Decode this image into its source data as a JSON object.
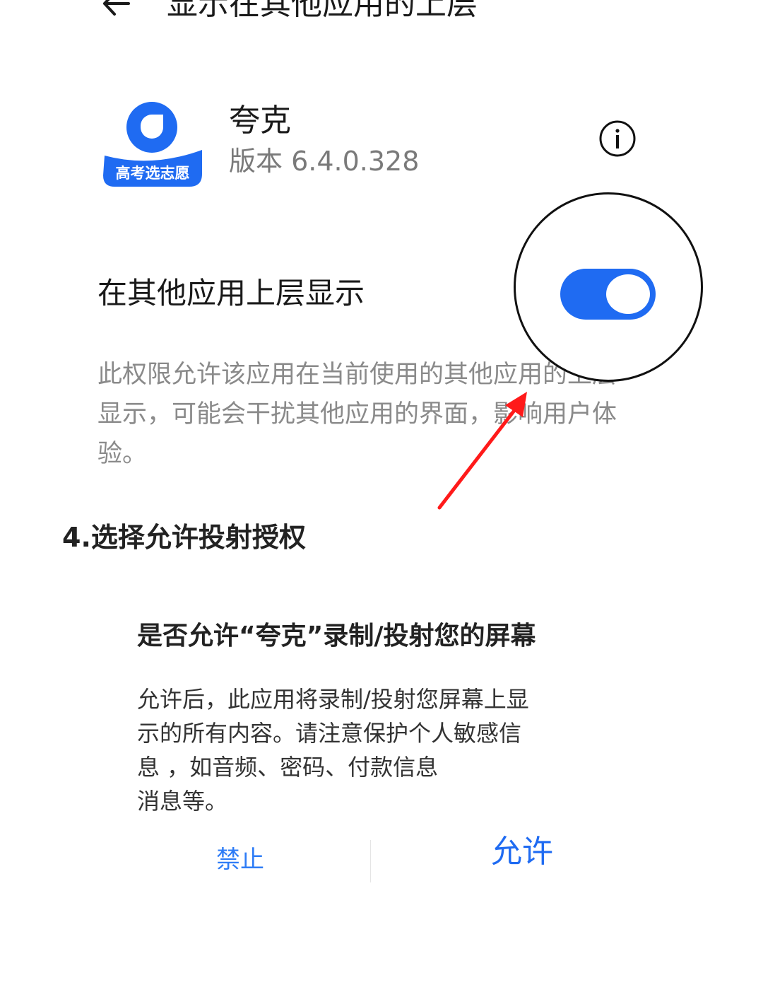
{
  "header": {
    "title": "显示在其他应用的上层"
  },
  "app": {
    "name": "夸克",
    "version": "版本 6.4.0.328",
    "logo_text": "高考选志愿",
    "logo_color": "#1f6bf2"
  },
  "setting": {
    "label": "在其他应用上层显示",
    "toggle_on": true,
    "toggle_color": "#1f6bf2",
    "description": "此权限允许该应用在当前使用的其他应用的上层显示，可能会干扰其他应用的界面，影响用户体验。"
  },
  "step": {
    "caption": "4.选择允许投射授权"
  },
  "dialog": {
    "title": "是否允许“夸克”录制/投射您的屏幕",
    "body_lines": [
      "允许后，此应用将录制/投射您屏幕上显",
      "示的所有内容。请注意保护个人敏感信",
      "息 ，如音频、密码、付款信息",
      "消息等。"
    ],
    "deny_label": "禁止",
    "allow_label": "允许",
    "accent_color": "#1f6bf2"
  },
  "annotation": {
    "arrow_color": "#ff1a1a"
  }
}
